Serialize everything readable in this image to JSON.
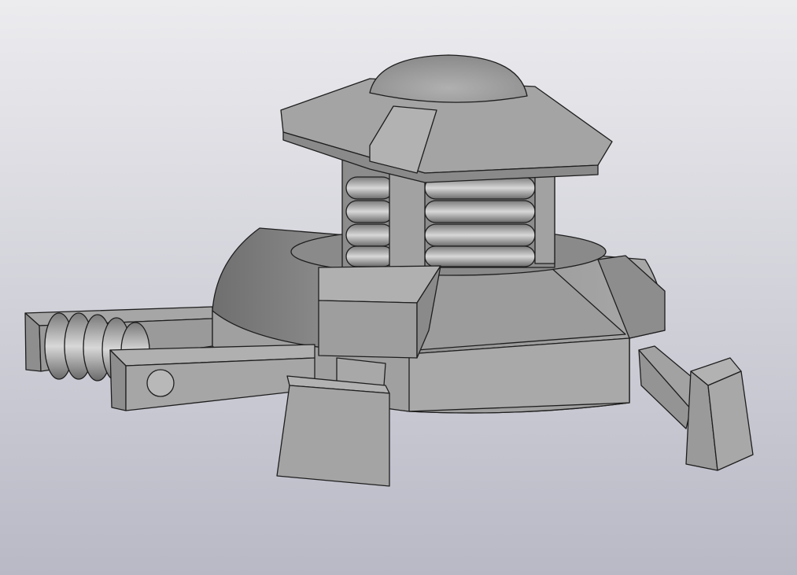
{
  "viewport": {
    "background_top": "#ececef",
    "background_bottom": "#b9b9c6",
    "model_light": "#b4b4b4",
    "model_mid": "#9a9a9a",
    "model_dark": "#7c7c7c",
    "edge": "#1e1e1e"
  }
}
